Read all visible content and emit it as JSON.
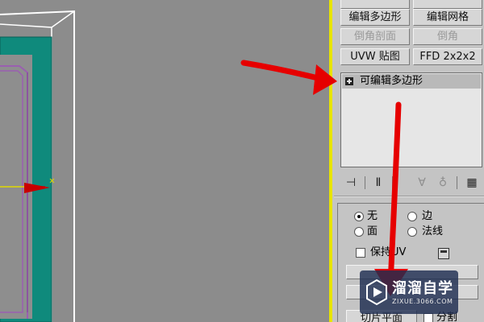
{
  "modifier_buttons": [
    {
      "id": "top-left",
      "label": "",
      "disabled": false
    },
    {
      "id": "top-right",
      "label": "",
      "disabled": false
    },
    {
      "id": "edit-poly",
      "label": "编辑多边形",
      "disabled": false
    },
    {
      "id": "edit-mesh",
      "label": "编辑网格",
      "disabled": false
    },
    {
      "id": "bevel-profile",
      "label": "倒角剖面",
      "disabled": true
    },
    {
      "id": "bevel",
      "label": "倒角",
      "disabled": true
    },
    {
      "id": "uvw-map",
      "label": "UVW 贴图",
      "disabled": false
    },
    {
      "id": "ffd",
      "label": "FFD 2x2x2",
      "disabled": false
    }
  ],
  "modifier_stack": {
    "items": [
      {
        "label": "可编辑多边形"
      }
    ]
  },
  "stack_tools": [
    {
      "name": "pin-stack-icon",
      "glyph": "⊣",
      "dim": false
    },
    {
      "name": "show-end-result-icon",
      "glyph": "Ⅱ",
      "dim": false
    },
    {
      "name": "make-unique-icon",
      "glyph": "∀",
      "dim": true
    },
    {
      "name": "remove-modifier-icon",
      "glyph": "♁",
      "dim": true
    },
    {
      "name": "configure-sets-icon",
      "glyph": "▦",
      "dim": false
    }
  ],
  "selection_rollout": {
    "options": [
      {
        "label": "无",
        "selected": true
      },
      {
        "label": "边",
        "selected": false
      },
      {
        "label": "面",
        "selected": false
      },
      {
        "label": "法线",
        "selected": false
      }
    ],
    "preserve_uv_label": "保持UV",
    "slice_plane_label": "切片平面",
    "split_label": "分割"
  },
  "watermark": {
    "title": "溜溜自学",
    "url": "ZIXUE.3066.COM"
  },
  "colors": {
    "viewport_bg": "#8c8c8c",
    "active_border": "#e8e400",
    "teal_frame": "#0f8a7c",
    "annotation_arrow": "#e60000"
  }
}
